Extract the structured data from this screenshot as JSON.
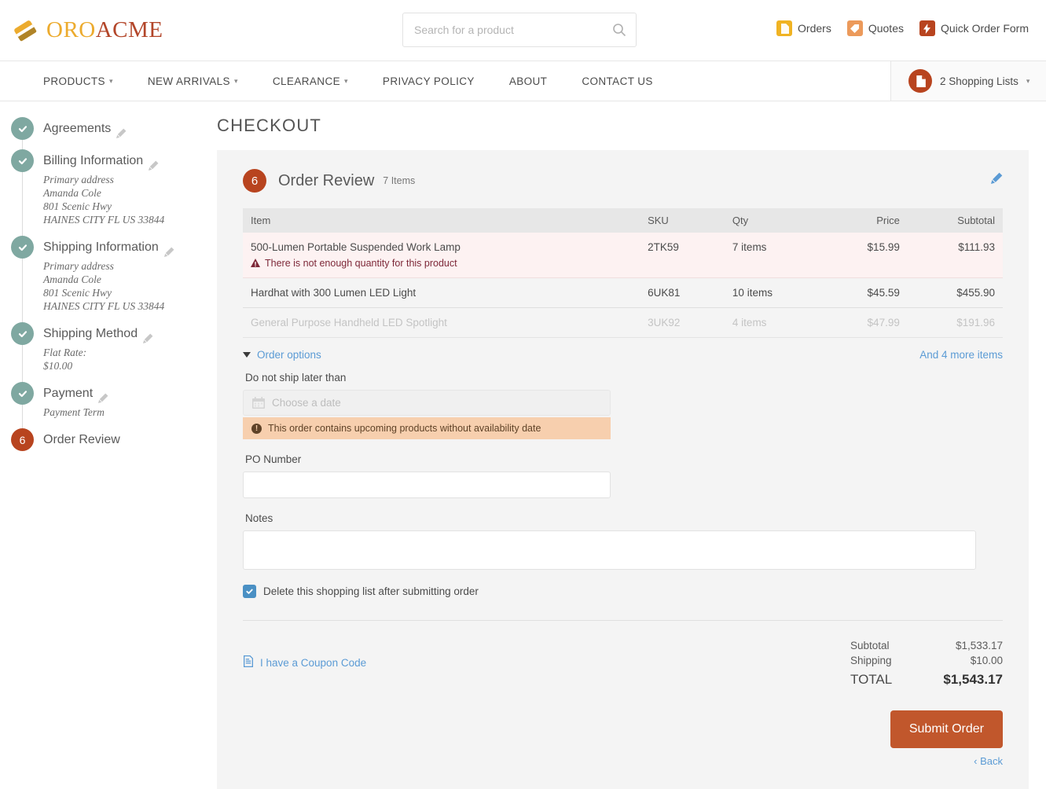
{
  "brand": {
    "name_part1": "ORO",
    "name_part2": "ACME",
    "color_primary": "#ecab2e",
    "color_secondary": "#b3462a"
  },
  "search": {
    "placeholder": "Search for a product",
    "value": ""
  },
  "header_links": [
    {
      "label": "Orders",
      "icon": "document-icon",
      "color": "#f0b323"
    },
    {
      "label": "Quotes",
      "icon": "tag-icon",
      "color": "#ec9a5b"
    },
    {
      "label": "Quick Order Form",
      "icon": "lightning-icon",
      "color": "#b8441f"
    }
  ],
  "nav": {
    "items": [
      {
        "label": "PRODUCTS",
        "has_dropdown": true
      },
      {
        "label": "NEW ARRIVALS",
        "has_dropdown": true
      },
      {
        "label": "CLEARANCE",
        "has_dropdown": true
      },
      {
        "label": "PRIVACY POLICY",
        "has_dropdown": false
      },
      {
        "label": "ABOUT",
        "has_dropdown": false
      },
      {
        "label": "CONTACT US",
        "has_dropdown": false
      }
    ],
    "shopping_lists": "2 Shopping Lists"
  },
  "steps": [
    {
      "marker": "check",
      "title": "Agreements",
      "editable": true,
      "sub": []
    },
    {
      "marker": "check",
      "title": "Billing Information",
      "editable": true,
      "sub": [
        "Primary address",
        "Amanda Cole",
        "801 Scenic Hwy",
        "HAINES CITY FL US 33844"
      ]
    },
    {
      "marker": "check",
      "title": "Shipping Information",
      "editable": true,
      "sub": [
        "Primary address",
        "Amanda Cole",
        "801 Scenic Hwy",
        "HAINES CITY FL US 33844"
      ]
    },
    {
      "marker": "check",
      "title": "Shipping Method",
      "editable": true,
      "sub": [
        "Flat Rate:",
        "$10.00"
      ]
    },
    {
      "marker": "check",
      "title": "Payment",
      "editable": true,
      "sub": [
        "Payment Term"
      ]
    },
    {
      "marker": "6",
      "title": "Order Review",
      "editable": false,
      "sub": []
    }
  ],
  "main": {
    "page_title": "CHECKOUT",
    "panel": {
      "step_number": "6",
      "title": "Order Review",
      "item_count": "7 Items",
      "edit_icon": "pencil-icon"
    },
    "table": {
      "headers": [
        "Item",
        "SKU",
        "Qty",
        "Price",
        "Subtotal"
      ],
      "rows": [
        {
          "item": "500-Lumen Portable Suspended Work Lamp",
          "sku": "2TK59",
          "qty": "7 items",
          "price": "$15.99",
          "subtotal": "$111.93",
          "state": "error",
          "error": "There is not enough quantity for this product"
        },
        {
          "item": "Hardhat with 300 Lumen LED Light",
          "sku": "6UK81",
          "qty": "10 items",
          "price": "$45.59",
          "subtotal": "$455.90",
          "state": "normal",
          "error": ""
        },
        {
          "item": "General Purpose Handheld LED Spotlight",
          "sku": "3UK92",
          "qty": "4 items",
          "price": "$47.99",
          "subtotal": "$191.96",
          "state": "faded",
          "error": ""
        }
      ]
    },
    "options": {
      "toggle_label": "Order options",
      "more_items_label": "And 4 more items",
      "ship_label": "Do not ship later than",
      "date_placeholder": "Choose a date",
      "date_value": "",
      "notice": "This order contains upcoming products without availability date",
      "po_label": "PO Number",
      "po_value": "",
      "notes_label": "Notes",
      "notes_value": "",
      "delete_list_label": "Delete this shopping list after submitting order",
      "delete_list_checked": true
    },
    "footer": {
      "coupon_label": "I have a Coupon Code",
      "totals": [
        {
          "label": "Subtotal",
          "value": "$1,533.17"
        },
        {
          "label": "Shipping",
          "value": "$10.00"
        }
      ],
      "grand_label": "TOTAL",
      "grand_value": "$1,543.17",
      "submit_label": "Submit Order",
      "back_label": "‹ Back"
    }
  }
}
